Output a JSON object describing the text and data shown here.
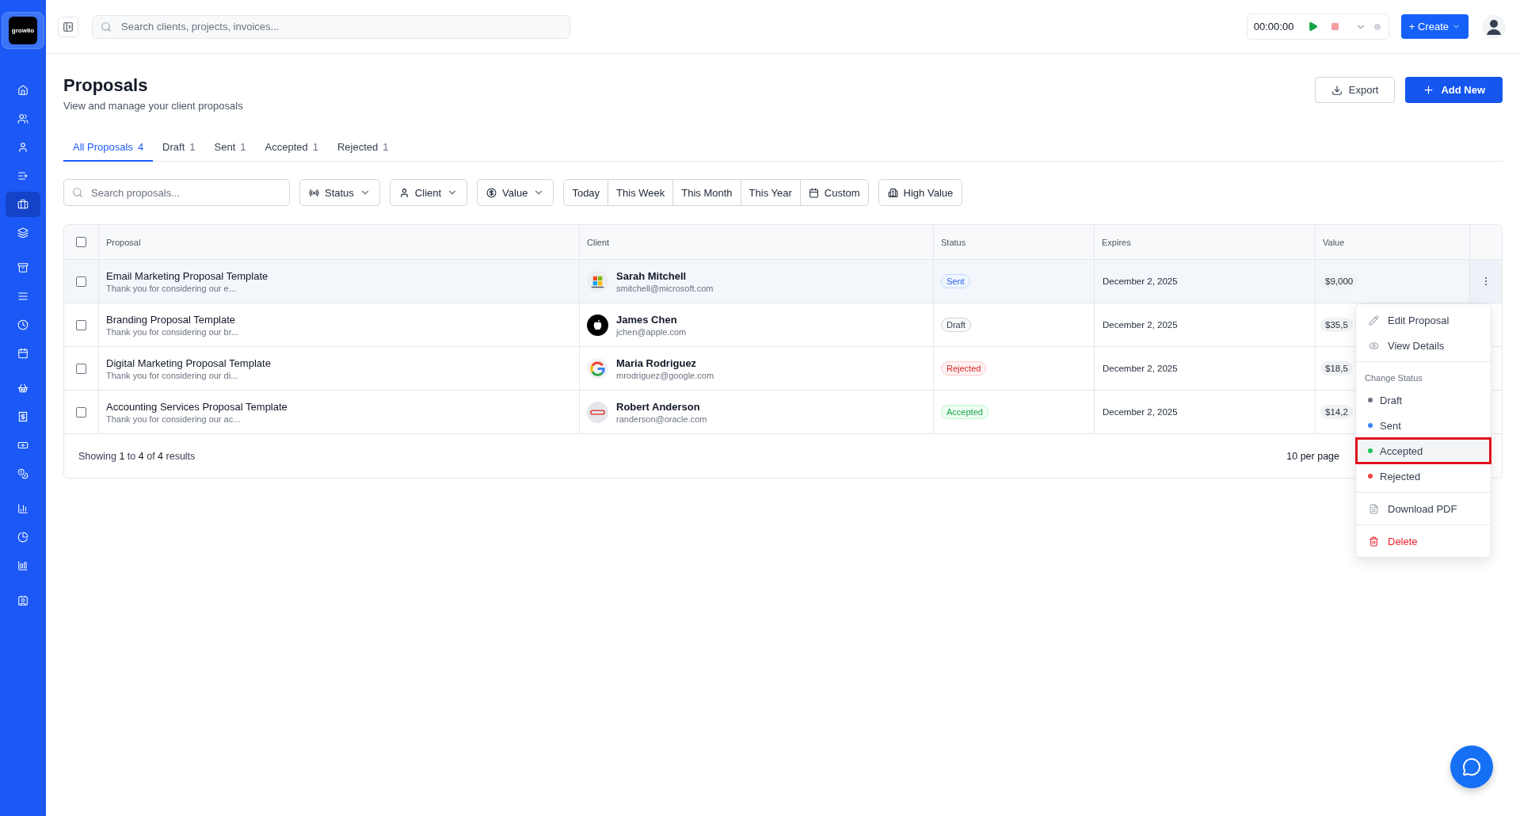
{
  "sidebar": {
    "logo": "growlio",
    "items": [
      {
        "selected": false
      },
      {
        "selected": false
      },
      {
        "selected": false
      },
      {
        "selected": false
      },
      {
        "selected": true
      },
      {
        "selected": false
      },
      {
        "selected": false
      },
      {
        "selected": false
      },
      {
        "selected": false
      },
      {
        "selected": false
      },
      {
        "selected": false
      },
      {
        "selected": false
      },
      {
        "selected": false
      },
      {
        "selected": false
      },
      {
        "selected": false
      },
      {
        "selected": false
      },
      {
        "selected": false
      },
      {
        "selected": false
      }
    ]
  },
  "topbar": {
    "search": {
      "placeholder": "Search clients, projects, invoices..."
    },
    "timer": {
      "time": "00:00:00"
    },
    "create_button": "+ Create"
  },
  "page": {
    "title": "Proposals",
    "subtitle": "View and manage your client proposals",
    "export_button": "Export",
    "add_button": "Add New"
  },
  "tabs": [
    {
      "label": "All Proposals",
      "count": "4",
      "selected": true
    },
    {
      "label": "Draft",
      "count": "1",
      "selected": false
    },
    {
      "label": "Sent",
      "count": "1",
      "selected": false
    },
    {
      "label": "Accepted",
      "count": "1",
      "selected": false
    },
    {
      "label": "Rejected",
      "count": "1",
      "selected": false
    }
  ],
  "filters": {
    "search": {
      "placeholder": "Search proposals..."
    },
    "dropdowns": [
      "Status",
      "Client",
      "Value"
    ],
    "date_ranges": [
      "Today",
      "This Week",
      "This Month",
      "This Year",
      "Custom"
    ],
    "high_value": "High Value"
  },
  "table": {
    "columns": [
      "Proposal",
      "Client",
      "Status",
      "Expires",
      "Value"
    ],
    "select_all_checked": false,
    "rows": [
      {
        "checked": false,
        "menu_open": true,
        "title": "Email Marketing Proposal Template",
        "excerpt": "Thank you for considering our e...",
        "client": {
          "name": "Sarah Mitchell",
          "email": "smitchell@microsoft.com"
        },
        "status": {
          "label": "Sent",
          "kind": "sent"
        },
        "expires": "December 2, 2025",
        "value": "$9,000"
      },
      {
        "checked": false,
        "title": "Branding Proposal Template",
        "excerpt": "Thank you for considering our br...",
        "client": {
          "name": "James Chen",
          "email": "jchen@apple.com"
        },
        "status": {
          "label": "Draft",
          "kind": "draft"
        },
        "expires": "December 2, 2025",
        "value": "$35,5"
      },
      {
        "checked": false,
        "title": "Digital Marketing Proposal Template",
        "excerpt": "Thank you for considering our di...",
        "client": {
          "name": "Maria Rodriguez",
          "email": "mrodriguez@google.com"
        },
        "status": {
          "label": "Rejected",
          "kind": "rejected"
        },
        "expires": "December 2, 2025",
        "value": "$18,5"
      },
      {
        "checked": false,
        "title": "Accounting Services Proposal Template",
        "excerpt": "Thank you for considering our ac...",
        "client": {
          "name": "Robert Anderson",
          "email": "randerson@oracle.com"
        },
        "status": {
          "label": "Accepted",
          "kind": "accepted"
        },
        "expires": "December 2, 2025",
        "value": "$14,2"
      }
    ],
    "footer": {
      "summary": "Showing **1** to **4** of **4** results",
      "per_page": "10 per page"
    }
  },
  "row_menu": {
    "items": [
      {
        "kind": "action",
        "label": "Edit Proposal"
      },
      {
        "kind": "action",
        "label": "View Details"
      },
      {
        "kind": "heading",
        "label": "Change Status"
      },
      {
        "kind": "status",
        "label": "Draft",
        "color": "#6b7280",
        "highlighted": false
      },
      {
        "kind": "status",
        "label": "Sent",
        "color": "#3b82f6",
        "highlighted": false
      },
      {
        "kind": "status",
        "label": "Accepted",
        "color": "#22c55e",
        "highlighted": true
      },
      {
        "kind": "status",
        "label": "Rejected",
        "color": "#ef4444",
        "highlighted": false
      },
      {
        "kind": "action",
        "label": "Download PDF"
      },
      {
        "kind": "danger",
        "label": "Delete"
      }
    ]
  }
}
